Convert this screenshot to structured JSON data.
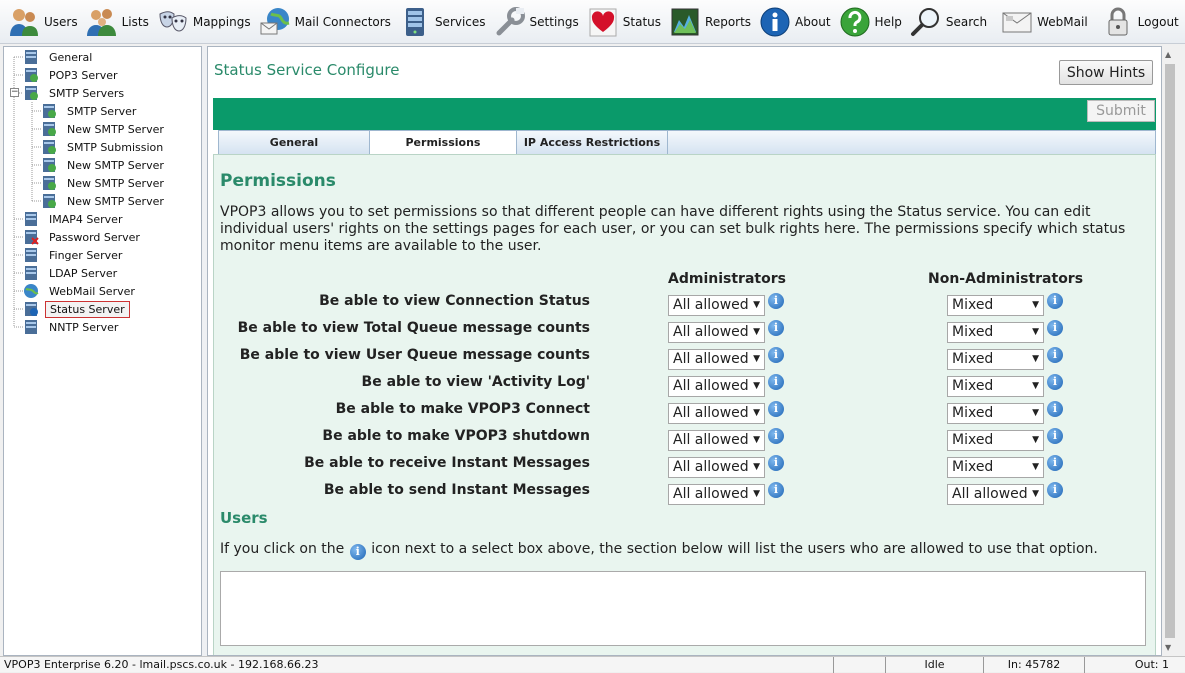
{
  "toolbar": {
    "items": [
      {
        "label": "Users",
        "icon": "users-icon"
      },
      {
        "label": "Lists",
        "icon": "lists-icon"
      },
      {
        "label": "Mappings",
        "icon": "masks-icon"
      },
      {
        "label": "Mail Connectors",
        "icon": "globe-mail-icon"
      },
      {
        "label": "Services",
        "icon": "server-icon"
      },
      {
        "label": "Settings",
        "icon": "wrench-icon"
      },
      {
        "label": "Status",
        "icon": "heart-icon"
      },
      {
        "label": "Reports",
        "icon": "chart-icon"
      },
      {
        "label": "About",
        "icon": "info-icon"
      },
      {
        "label": "Help",
        "icon": "help-icon"
      },
      {
        "label": "Search",
        "icon": "magnifier-icon"
      },
      {
        "label": "WebMail",
        "icon": "envelope-icon"
      },
      {
        "label": "Logout",
        "icon": "padlock-icon"
      }
    ]
  },
  "tree": {
    "items": [
      {
        "label": "General",
        "level": 0
      },
      {
        "label": "POP3 Server",
        "level": 0
      },
      {
        "label": "SMTP Servers",
        "level": 0,
        "expanded": true
      },
      {
        "label": "SMTP Server",
        "level": 1
      },
      {
        "label": "New SMTP Server",
        "level": 1
      },
      {
        "label": "SMTP Submission",
        "level": 1
      },
      {
        "label": "New SMTP Server",
        "level": 1
      },
      {
        "label": "New SMTP Server",
        "level": 1
      },
      {
        "label": "New SMTP Server",
        "level": 1
      },
      {
        "label": "IMAP4 Server",
        "level": 0
      },
      {
        "label": "Password Server",
        "level": 0
      },
      {
        "label": "Finger Server",
        "level": 0
      },
      {
        "label": "LDAP Server",
        "level": 0
      },
      {
        "label": "WebMail Server",
        "level": 0
      },
      {
        "label": "Status Server",
        "level": 0,
        "selected": true
      },
      {
        "label": "NNTP Server",
        "level": 0
      }
    ]
  },
  "main": {
    "title": "Status Service Configure",
    "show_hints_label": "Show Hints",
    "submit_label": "Submit",
    "tabs": [
      {
        "label": "General",
        "active": false
      },
      {
        "label": "Permissions",
        "active": true
      },
      {
        "label": "IP Access Restrictions",
        "active": false
      }
    ],
    "permissions": {
      "title": "Permissions",
      "intro": "VPOP3 allows you to set permissions so that different people can have different rights using the Status service. You can edit individual users' rights on the settings pages for each user, or you can set bulk rights here. The permissions specify which status monitor menu items are available to the user.",
      "col_admin": "Administrators",
      "col_nonadmin": "Non-Administrators",
      "rows": [
        {
          "label": "Be able to view Connection Status",
          "admin": "All allowed",
          "nonadmin": "Mixed"
        },
        {
          "label": "Be able to view Total Queue message counts",
          "admin": "All allowed",
          "nonadmin": "Mixed"
        },
        {
          "label": "Be able to view User Queue message counts",
          "admin": "All allowed",
          "nonadmin": "Mixed"
        },
        {
          "label": "Be able to view 'Activity Log'",
          "admin": "All allowed",
          "nonadmin": "Mixed"
        },
        {
          "label": "Be able to make VPOP3 Connect",
          "admin": "All allowed",
          "nonadmin": "Mixed"
        },
        {
          "label": "Be able to make VPOP3 shutdown",
          "admin": "All allowed",
          "nonadmin": "Mixed"
        },
        {
          "label": "Be able to receive Instant Messages",
          "admin": "All allowed",
          "nonadmin": "Mixed"
        },
        {
          "label": "Be able to send Instant Messages",
          "admin": "All allowed",
          "nonadmin": "All allowed"
        }
      ]
    },
    "users": {
      "title": "Users",
      "text_before": "If you click on the",
      "text_after": "icon next to a select box above, the section below will list the users who are allowed to use that option.",
      "list_value": ""
    }
  },
  "statusbar": {
    "product": "VPOP3 Enterprise 6.20 - lmail.pscs.co.uk - 192.168.66.23",
    "state": "Idle",
    "in": "In: 45782",
    "out": "Out: 1"
  },
  "colors": {
    "accent_green": "#0a9a6a",
    "title_green": "#2a8a6a",
    "panel_bg": "#e9f5ef"
  }
}
